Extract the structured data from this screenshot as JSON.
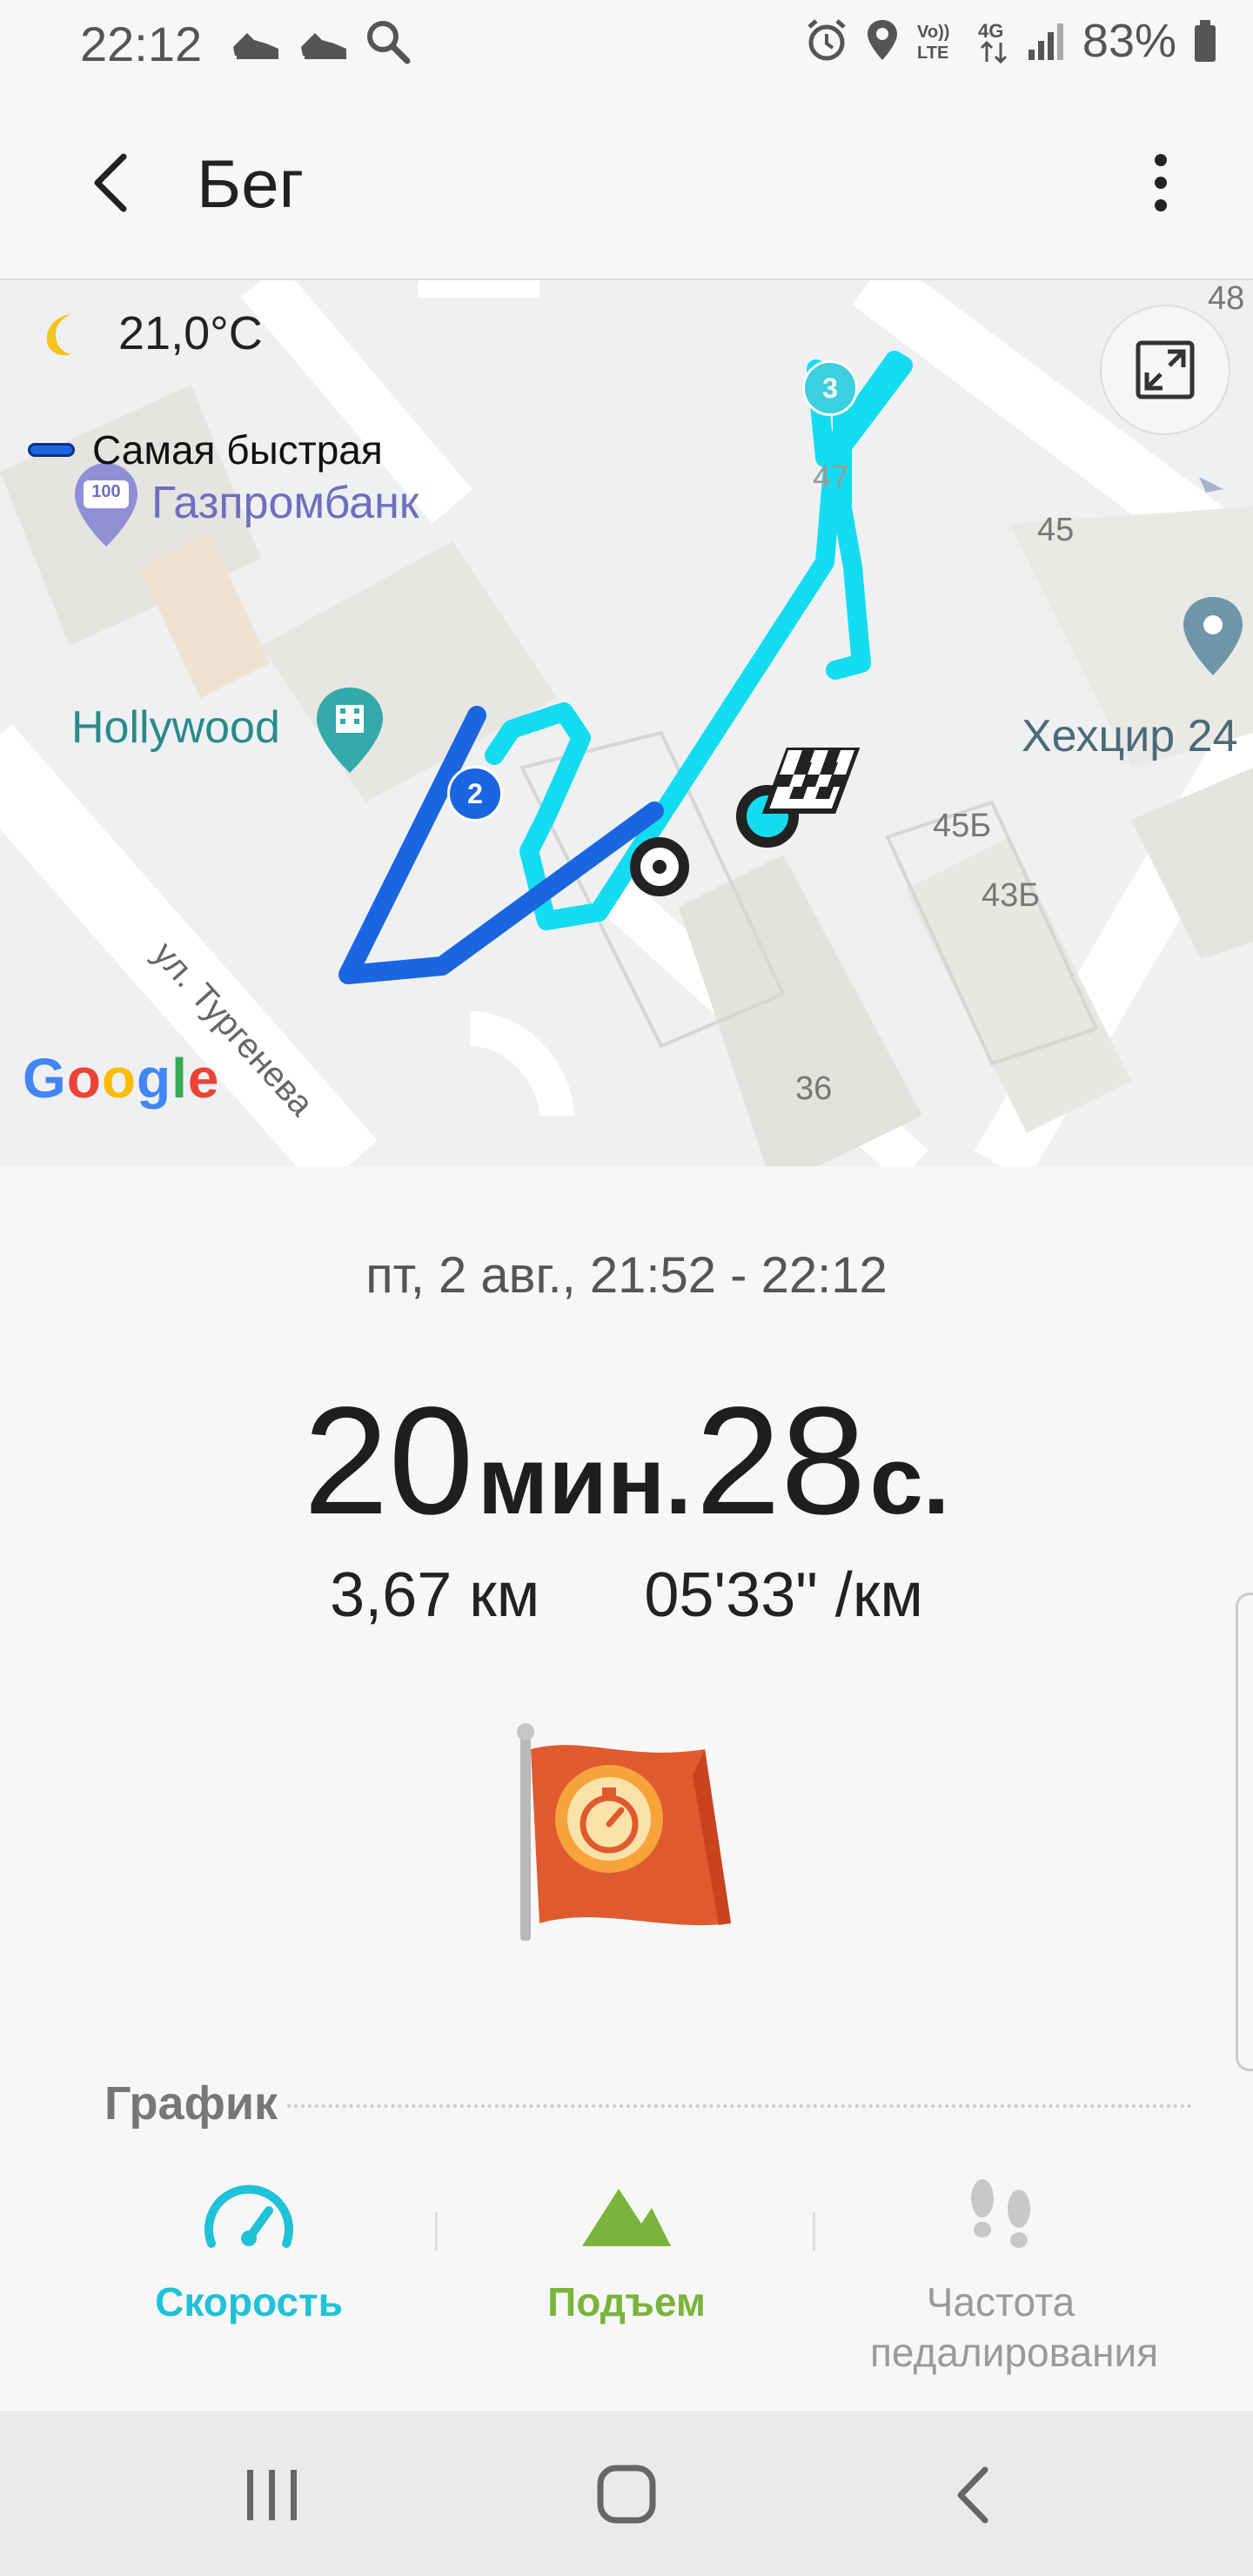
{
  "status_bar": {
    "time": "22:12",
    "battery": "83%",
    "icons": [
      "shoe-icon",
      "shoe-icon",
      "search-icon",
      "alarm-icon",
      "location-icon",
      "volte-icon",
      "4g-icon",
      "signal-icon",
      "battery-icon"
    ],
    "volte_text": "Vo)) LTE",
    "network_text": "4G"
  },
  "app_bar": {
    "title": "Бег"
  },
  "map": {
    "weather_temp": "21,0°C",
    "fastest_label": "Самая быстрая",
    "poi": {
      "bank": "Газпромбанк",
      "cinema": "Hollywood",
      "place": "Хехцир 24"
    },
    "bank_badge": "100",
    "numbers": [
      "48",
      "47",
      "45",
      "45Б",
      "43Б",
      "36"
    ],
    "street": "ул. Тургенева",
    "markers": [
      "2",
      "3"
    ],
    "google": [
      "G",
      "o",
      "o",
      "g",
      "l",
      "e"
    ],
    "colors": {
      "fast_route": "#1a66e0",
      "slow_route": "#14dcf0",
      "poi_teal": "#2a8a8a",
      "poi_bank": "#6e6fbf"
    }
  },
  "summary": {
    "date_range": "пт, 2 авг., 21:52 - 22:12",
    "minutes": "20",
    "minutes_unit": "мин.",
    "seconds": "28",
    "seconds_unit": "с.",
    "distance": "3,67 км",
    "pace": "05'33\" /км"
  },
  "graph": {
    "title": "График",
    "tabs": [
      {
        "label": "Скорость",
        "icon": "speedometer-icon",
        "color": "#1fc2d6"
      },
      {
        "label": "Подъем",
        "icon": "mountain-icon",
        "color": "#7ab43c"
      },
      {
        "label": "Частота педалирования",
        "icon": "footsteps-icon",
        "color": "#9a9a9a"
      }
    ]
  },
  "nav_bar": {
    "buttons": [
      "recent-apps-button",
      "home-button",
      "back-nav-button"
    ]
  }
}
